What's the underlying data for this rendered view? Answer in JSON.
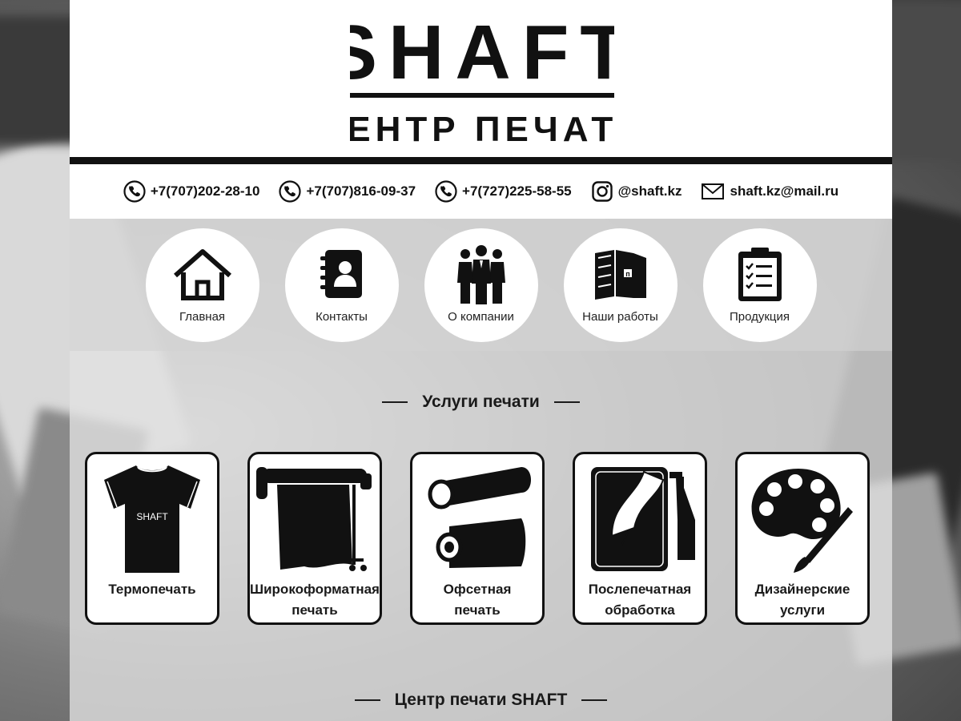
{
  "brand": {
    "name": "SHAFT",
    "subtitle": "ЦЕНТР ПЕЧАТИ"
  },
  "contacts": [
    {
      "icon": "phone-icon",
      "text": "+7(707)202-28-10"
    },
    {
      "icon": "phone-icon",
      "text": "+7(707)816-09-37"
    },
    {
      "icon": "phone-icon",
      "text": "+7(727)225-58-55"
    },
    {
      "icon": "instagram-icon",
      "text": "@shaft.kz"
    },
    {
      "icon": "mail-icon",
      "text": "shaft.kz@mail.ru"
    }
  ],
  "nav": [
    {
      "icon": "home-icon",
      "label": "Главная"
    },
    {
      "icon": "address-book-icon",
      "label": "Контакты"
    },
    {
      "icon": "people-icon",
      "label": "О компании"
    },
    {
      "icon": "books-icon",
      "label": "Наши работы"
    },
    {
      "icon": "clipboard-icon",
      "label": "Продукция"
    }
  ],
  "services_section": {
    "title": "Услуги печати"
  },
  "services": [
    {
      "icon": "tshirt-icon",
      "label": "Термопечать",
      "shirt_text": "SHAFT"
    },
    {
      "icon": "plotter-icon",
      "label": "Широкоформатная\nпечать"
    },
    {
      "icon": "paper-rolls-icon",
      "label": "Офсетная\nпечать"
    },
    {
      "icon": "lamination-icon",
      "label": "Послепечатная\nобработка"
    },
    {
      "icon": "palette-icon",
      "label": "Дизайнерские\nуслуги"
    }
  ],
  "about_section": {
    "title": "Центр печати SHAFT"
  }
}
